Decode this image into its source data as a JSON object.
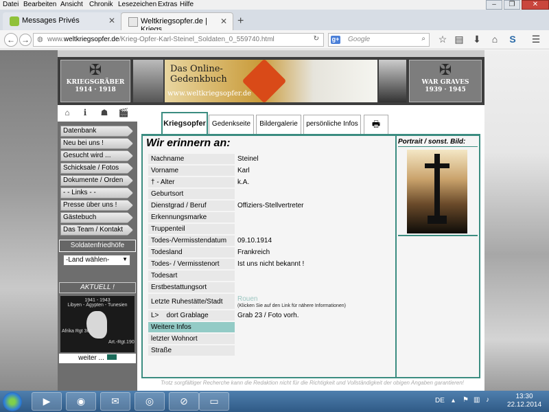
{
  "menubar": {
    "items": [
      "Datei",
      "Bearbeiten",
      "Ansicht",
      "Chronik",
      "Lesezeichen",
      "Extras",
      "Hilfe"
    ]
  },
  "tabs": [
    {
      "title": "Messages Privés",
      "icon": "message-icon"
    },
    {
      "title": "Weltkriegsopfer.de | Kriegs...",
      "icon": "page-icon"
    }
  ],
  "urlbar": {
    "prefix": "www.",
    "domain": "weltkriegsopfer.de",
    "path": "/Krieg-Opfer-Karl-Steinel_Soldaten_0_559740.html"
  },
  "search": {
    "placeholder": "Google",
    "engine": "g+"
  },
  "banner": {
    "left_caption1": "KRIEGSGRÄBER",
    "left_caption2": "1914 · 1918",
    "title1": "Das Online-",
    "title2": "Gedenkbuch",
    "url": "www.weltkriegsopfer.de",
    "right_caption1": "WAR GRAVES",
    "right_caption2": "1939 · 1945"
  },
  "sidebar": {
    "links": [
      "Datenbank",
      "Neu bei uns !",
      "Gesucht wird ...",
      "Schicksale / Fotos",
      "Dokumente / Orden",
      "- -  Links   - -",
      "Presse über uns !",
      "Gästebuch",
      "Das Team / Kontakt"
    ],
    "friedhoefe_title": "Soldatenfriedhöfe",
    "land_select": "-Land wählen-",
    "aktuell_title": "AKTUELL !",
    "aktuell_line1": "1941 - 1943",
    "aktuell_line2": "Libyen - Ägypten - Tunesien",
    "aktuell_left": "Afrika Rgt 361",
    "aktuell_right": "Art.-Rgt.190",
    "weiter": "weiter ..."
  },
  "content_tabs": [
    "Kriegsopfer",
    "Gedenkseite",
    "Bildergalerie",
    "persönliche Infos"
  ],
  "heading": "Wir erinnern an:",
  "fields": [
    {
      "label": "Nachname",
      "value": "Steinel"
    },
    {
      "label": "Vorname",
      "value": "Karl"
    },
    {
      "label": "† - Alter",
      "value": "k.A."
    },
    {
      "label": "Geburtsort",
      "value": ""
    },
    {
      "label": "Dienstgrad / Beruf",
      "value": "Offiziers-Stellvertreter"
    },
    {
      "label": "Erkennungsmarke",
      "value": ""
    },
    {
      "label": "Truppenteil",
      "value": ""
    },
    {
      "label": "Todes-/Vermisstendatum",
      "value": "09.10.1914"
    },
    {
      "label": "Todesland",
      "value": "Frankreich"
    },
    {
      "label": "Todes- / Vermisstenort",
      "value": "Ist uns nicht bekannt !"
    },
    {
      "label": "Todesart",
      "value": ""
    },
    {
      "label": "Erstbestattungsort",
      "value": ""
    },
    {
      "label": "Letzte Ruhestätte/Stadt",
      "value": ""
    },
    {
      "label": "dort Grablage",
      "value": "Grab 23 / Foto vorh."
    },
    {
      "label": "Weitere Infos",
      "value": ""
    },
    {
      "label": "letzter Wohnort",
      "value": ""
    },
    {
      "label": "Straße",
      "value": ""
    }
  ],
  "grab_arrow": "L>",
  "ruhestaette_link": "Rouen",
  "ruhestaette_note": "(Klicken Sie auf den Link für nähere Informationen)",
  "portrait_title": "Portrait / sonst. Bild:",
  "disclaimer": "Trotz sorgfältiger Recherche kann die Redaktion nicht für die Richtigkeit und Vollständigkeit der obigen Angaben garantieren!",
  "taskbar": {
    "lang": "DE",
    "time": "13:30",
    "date": "22.12.2014"
  },
  "colors": {
    "accent": "#3a8c80",
    "highlight": "#93cbc6",
    "link": "#9bc6c1"
  }
}
